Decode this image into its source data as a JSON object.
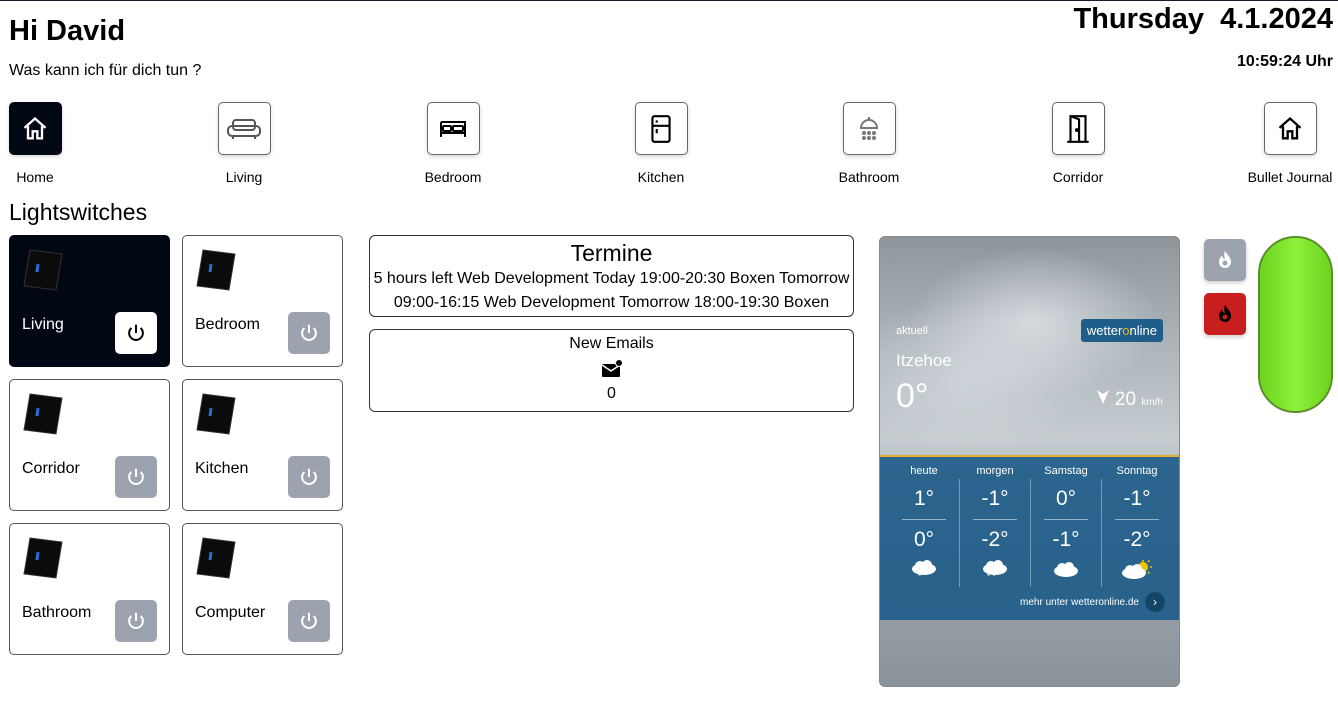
{
  "header": {
    "greeting": "Hi David",
    "subtitle": "Was kann ich für dich tun ?",
    "date": "Thursday  4.1.2024",
    "time": "10:59:24 Uhr"
  },
  "nav": [
    {
      "label": "Home",
      "icon": "home-icon",
      "active": true
    },
    {
      "label": "Living",
      "icon": "sofa-icon",
      "active": false
    },
    {
      "label": "Bedroom",
      "icon": "bed-icon",
      "active": false
    },
    {
      "label": "Kitchen",
      "icon": "fridge-icon",
      "active": false
    },
    {
      "label": "Bathroom",
      "icon": "shower-icon",
      "active": false
    },
    {
      "label": "Corridor",
      "icon": "door-icon",
      "active": false
    },
    {
      "label": "Bullet Journal",
      "icon": "home-icon",
      "active": false
    }
  ],
  "lightswitches": {
    "title": "Lightswitches",
    "items": [
      {
        "label": "Living",
        "on": true
      },
      {
        "label": "Bedroom",
        "on": false
      },
      {
        "label": "Corridor",
        "on": false
      },
      {
        "label": "Kitchen",
        "on": false
      },
      {
        "label": "Bathroom",
        "on": false
      },
      {
        "label": "Computer",
        "on": false
      }
    ]
  },
  "termine": {
    "title": "Termine",
    "text": "5 hours left Web Development Today 19:00-20:30 Boxen Tomorrow 09:00-16:15 Web Development Tomorrow 18:00-19:30 Boxen"
  },
  "emails": {
    "title": "New Emails",
    "count": "0",
    "icon": "mail-badge-icon"
  },
  "weather": {
    "label_now": "aktuell",
    "brand_a": "wetter",
    "brand_o": "o",
    "brand_b": "nline",
    "city": "Itzehoe",
    "temp": "0°",
    "wind": "20",
    "wind_unit": "km/h",
    "days": [
      {
        "day": "heute",
        "hi": "1°",
        "lo": "0°",
        "icon": "snow-cloud-icon"
      },
      {
        "day": "morgen",
        "hi": "-1°",
        "lo": "-2°",
        "icon": "snow-cloud-icon"
      },
      {
        "day": "Samstag",
        "hi": "0°",
        "lo": "-1°",
        "icon": "cloud-icon"
      },
      {
        "day": "Sonntag",
        "hi": "-1°",
        "lo": "-2°",
        "icon": "sun-cloud-icon"
      }
    ],
    "more": "mehr unter wetteronline.de"
  },
  "heating": {
    "off_icon": "flame-icon",
    "on_icon": "flame-icon",
    "off_color": "#9ca3af",
    "on_color": "#c81e1e"
  },
  "level": {
    "fraction": 1.0,
    "color": "#7fe52b"
  },
  "colors": {
    "dark": "#020714",
    "inactive": "#9ca3af",
    "weather_blue": "#1f5d8a"
  }
}
